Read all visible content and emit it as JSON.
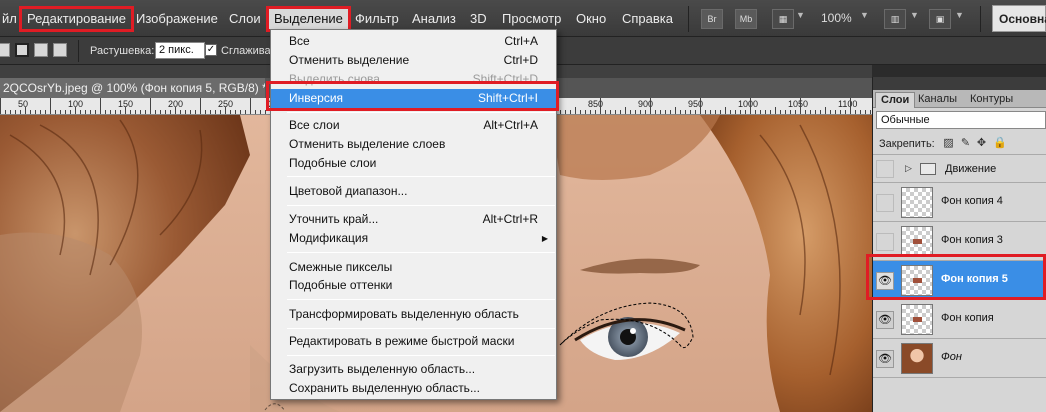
{
  "menubar": {
    "items": [
      "йл",
      "Редактирование",
      "Изображение",
      "Слои",
      "Выделение",
      "Фильтр",
      "Анализ",
      "3D",
      "Просмотр",
      "Окно",
      "Справка"
    ],
    "buttons": [
      "Br",
      "Mb"
    ],
    "zoom": "100%",
    "workspace": "Основна"
  },
  "options": {
    "feather_label": "Растушевка:",
    "feather_value": "2 пикс.",
    "antialias_label": "Сглаживан",
    "antialias_checked": true
  },
  "document": {
    "tab_title": "2QCOsrYb.jpeg @ 100% (Фон копия 5, RGB/8) *",
    "ruler_labels": [
      "50",
      "100",
      "150",
      "200",
      "250",
      "300",
      "350",
      "400",
      "450",
      "850",
      "900",
      "950",
      "1000",
      "1050",
      "1100"
    ]
  },
  "select_menu": {
    "items": [
      {
        "label": "Все",
        "shortcut": "Ctrl+A",
        "state": "normal"
      },
      {
        "label": "Отменить выделение",
        "shortcut": "Ctrl+D",
        "state": "normal"
      },
      {
        "label": "Выделить снова",
        "shortcut": "Shift+Ctrl+D",
        "state": "disabled"
      },
      {
        "label": "Инверсия",
        "shortcut": "Shift+Ctrl+I",
        "state": "highlight"
      },
      {
        "label": "Все слои",
        "shortcut": "Alt+Ctrl+A",
        "state": "normal"
      },
      {
        "label": "Отменить выделение слоев",
        "shortcut": "",
        "state": "normal"
      },
      {
        "label": "Подобные слои",
        "shortcut": "",
        "state": "normal"
      },
      {
        "label": "Цветовой диапазон...",
        "shortcut": "",
        "state": "normal"
      },
      {
        "label": "Уточнить край...",
        "shortcut": "Alt+Ctrl+R",
        "state": "normal"
      },
      {
        "label": "Модификация",
        "shortcut": "",
        "state": "submenu"
      },
      {
        "label": "Смежные пикселы",
        "shortcut": "",
        "state": "normal"
      },
      {
        "label": "Подобные оттенки",
        "shortcut": "",
        "state": "normal"
      },
      {
        "label": "Трансформировать выделенную область",
        "shortcut": "",
        "state": "normal"
      },
      {
        "label": "Редактировать в режиме быстрой маски",
        "shortcut": "",
        "state": "normal"
      },
      {
        "label": "Загрузить выделенную область...",
        "shortcut": "",
        "state": "normal"
      },
      {
        "label": "Сохранить выделенную область...",
        "shortcut": "",
        "state": "normal"
      }
    ]
  },
  "layers_panel": {
    "tabs": [
      "Слои",
      "Каналы",
      "Контуры"
    ],
    "active_tab": "Слои",
    "blend_mode": "Обычные",
    "lock_label": "Закрепить:",
    "layers": [
      {
        "name": "Движение",
        "type": "group",
        "visible": false,
        "selected": false
      },
      {
        "name": "Фон копия 4",
        "type": "layer",
        "visible": false,
        "selected": false
      },
      {
        "name": "Фон копия 3",
        "type": "layer",
        "visible": false,
        "selected": false
      },
      {
        "name": "Фон копия 5",
        "type": "layer",
        "visible": true,
        "selected": true
      },
      {
        "name": "Фон копия",
        "type": "layer",
        "visible": true,
        "selected": false
      },
      {
        "name": "Фон",
        "type": "background",
        "visible": true,
        "selected": false
      }
    ]
  },
  "colors": {
    "highlight": "#3a8ee6",
    "annotation_red": "#e01c24"
  }
}
